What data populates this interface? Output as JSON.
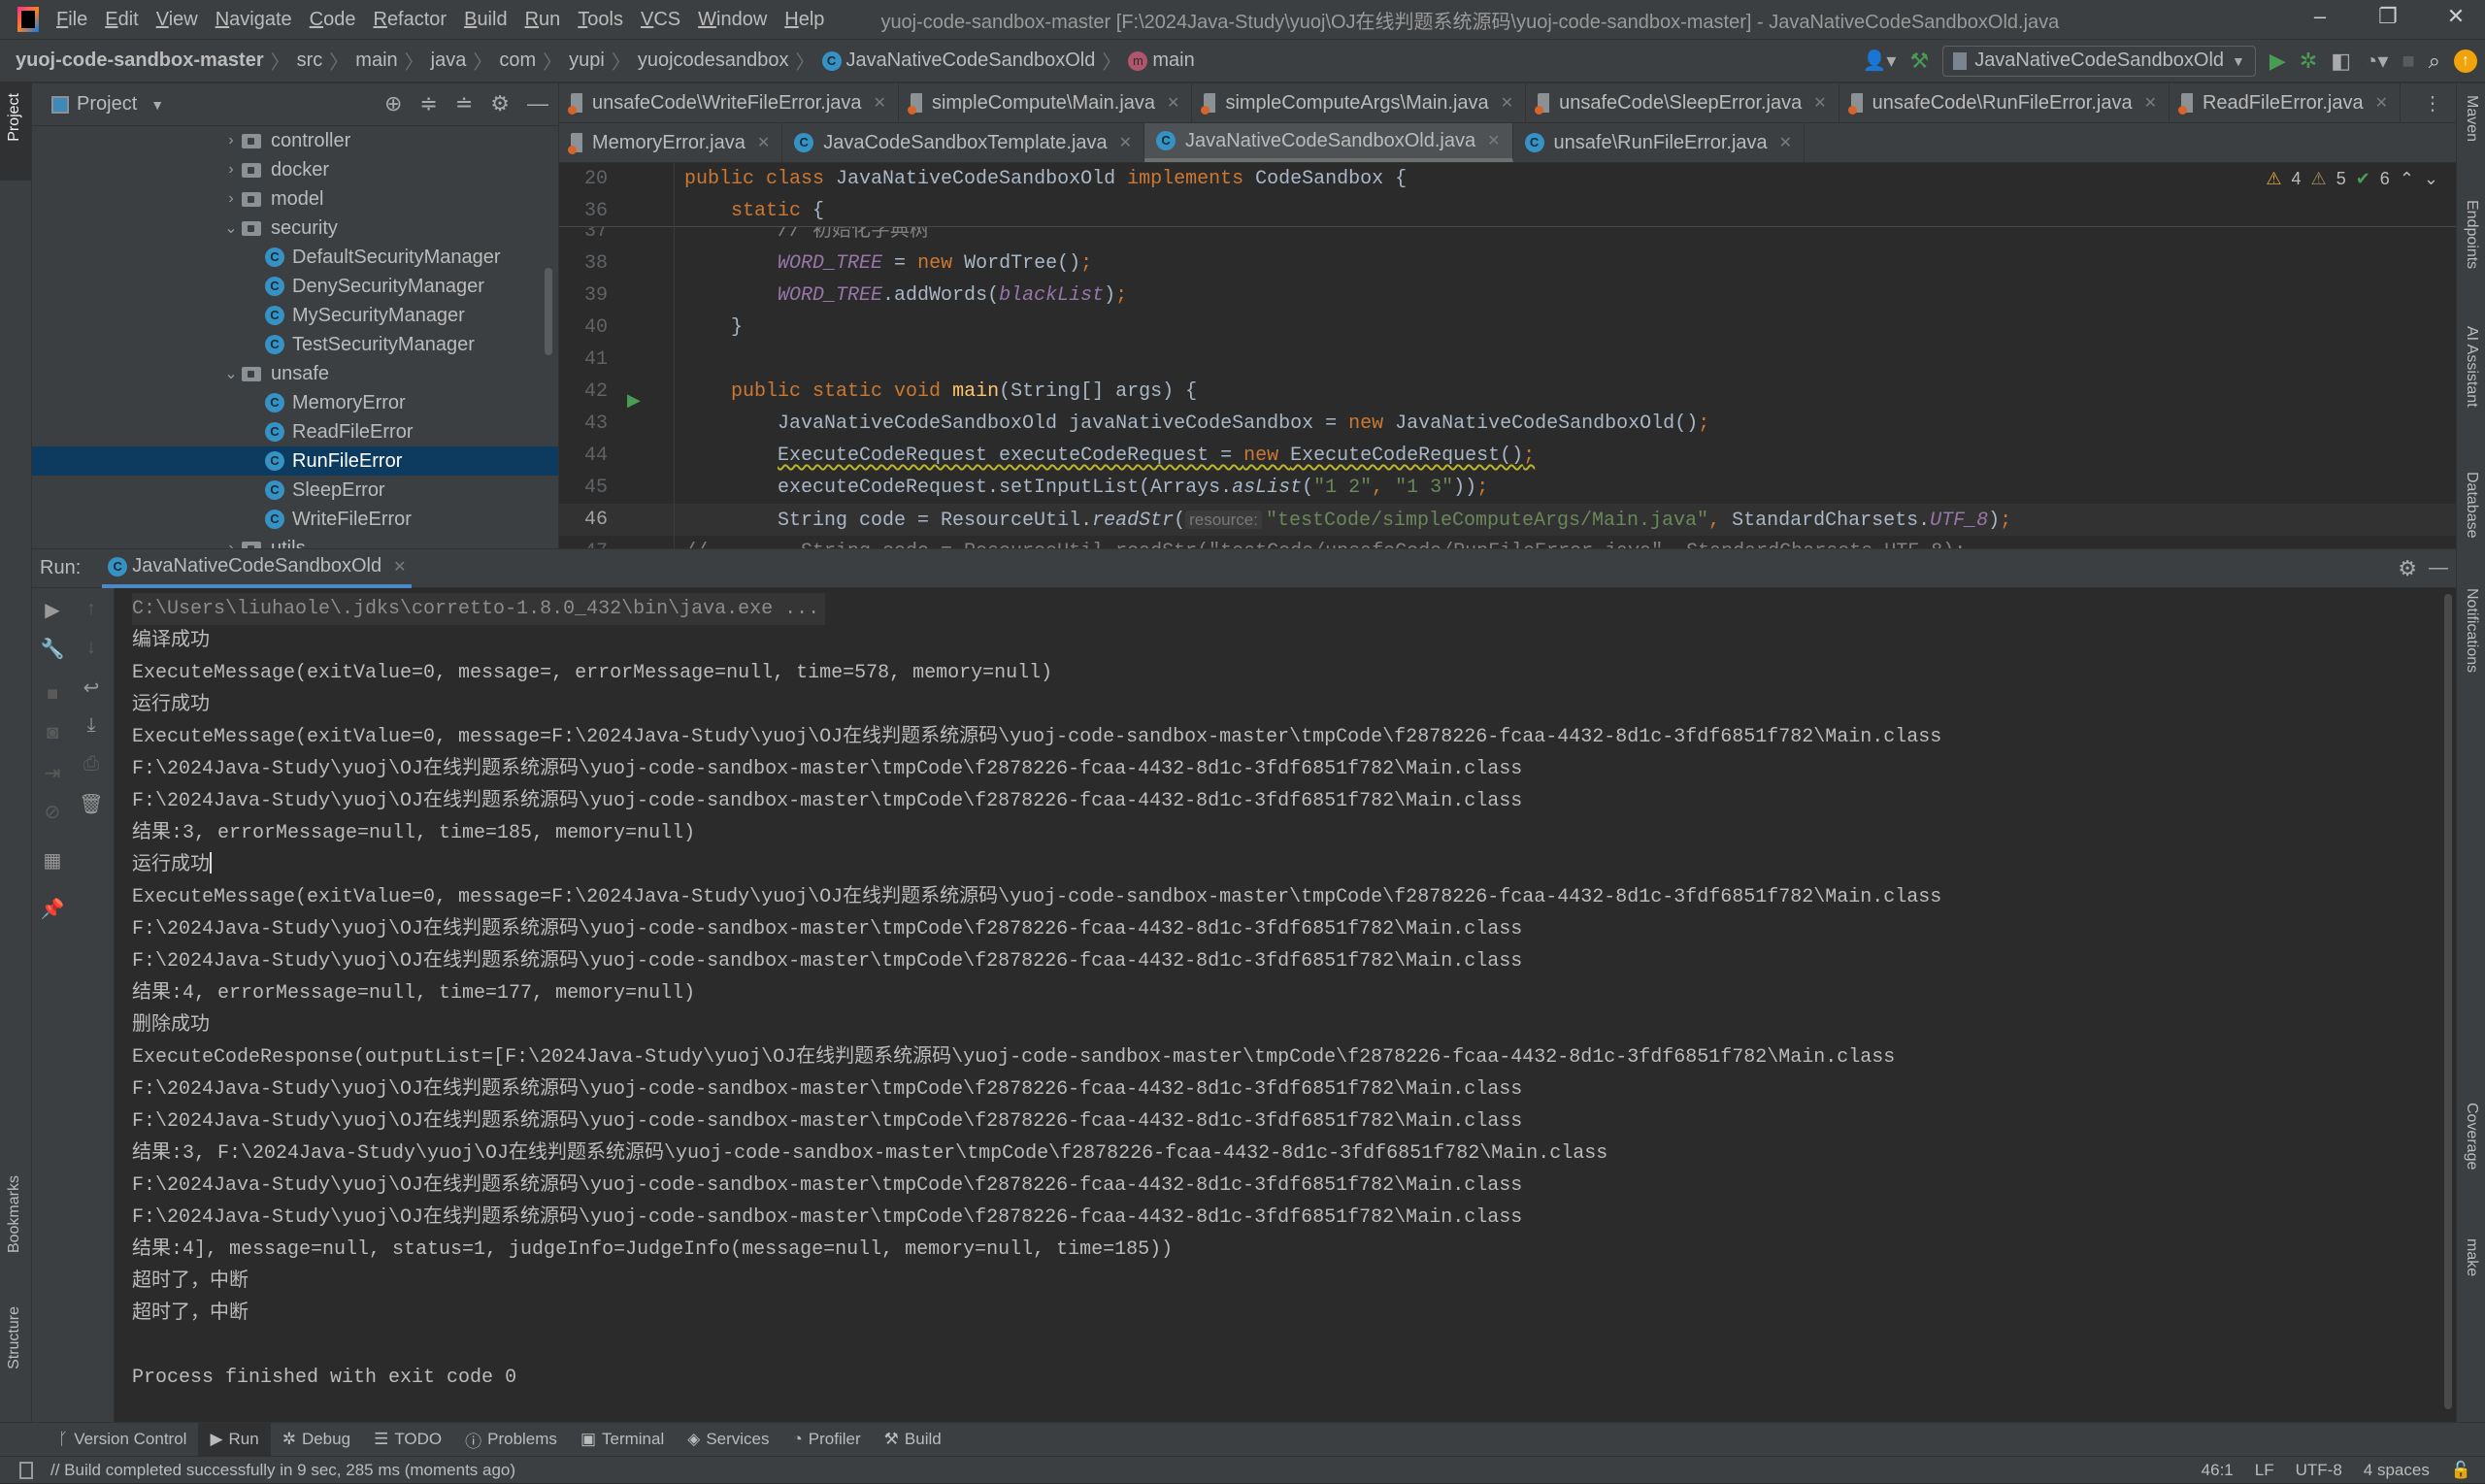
{
  "window": {
    "title": "yuoj-code-sandbox-master [F:\\2024Java-Study\\yuoj\\OJ在线判题系统源码\\yuoj-code-sandbox-master] - JavaNativeCodeSandboxOld.java",
    "menu": [
      "File",
      "Edit",
      "View",
      "Navigate",
      "Code",
      "Refactor",
      "Build",
      "Run",
      "Tools",
      "VCS",
      "Window",
      "Help"
    ]
  },
  "breadcrumb": {
    "items": [
      "yuoj-code-sandbox-master",
      "src",
      "main",
      "java",
      "com",
      "yupi",
      "yuojcodesandbox",
      "JavaNativeCodeSandboxOld",
      "main"
    ],
    "run_config": "JavaNativeCodeSandboxOld"
  },
  "left_stripe": {
    "project": "Project",
    "bookmarks": "Bookmarks",
    "structure": "Structure"
  },
  "right_stripe": [
    "Maven",
    "Endpoints",
    "AI Assistant",
    "Database",
    "Notifications",
    "Coverage",
    "make"
  ],
  "project": {
    "title": "Project",
    "tree": [
      {
        "label": "controller",
        "type": "folder",
        "level": 0,
        "state": "collapsed"
      },
      {
        "label": "docker",
        "type": "folder",
        "level": 0,
        "state": "collapsed"
      },
      {
        "label": "model",
        "type": "folder",
        "level": 0,
        "state": "collapsed"
      },
      {
        "label": "security",
        "type": "folder",
        "level": 0,
        "state": "expanded"
      },
      {
        "label": "DefaultSecurityManager",
        "type": "class",
        "level": 1
      },
      {
        "label": "DenySecurityManager",
        "type": "class",
        "level": 1
      },
      {
        "label": "MySecurityManager",
        "type": "class",
        "level": 1
      },
      {
        "label": "TestSecurityManager",
        "type": "class",
        "level": 1
      },
      {
        "label": "unsafe",
        "type": "folder",
        "level": 0,
        "state": "expanded"
      },
      {
        "label": "MemoryError",
        "type": "class",
        "level": 1
      },
      {
        "label": "ReadFileError",
        "type": "class",
        "level": 1
      },
      {
        "label": "RunFileError",
        "type": "class",
        "level": 1,
        "selected": true
      },
      {
        "label": "SleepError",
        "type": "class",
        "level": 1
      },
      {
        "label": "WriteFileError",
        "type": "class",
        "level": 1
      },
      {
        "label": "utils",
        "type": "folder",
        "level": 0,
        "state": "collapsed"
      }
    ]
  },
  "editor": {
    "tabs_row1": [
      {
        "label": "unsafeCode\\WriteFileError.java",
        "icon": "java-file"
      },
      {
        "label": "simpleCompute\\Main.java",
        "icon": "java-file"
      },
      {
        "label": "simpleComputeArgs\\Main.java",
        "icon": "java-file"
      },
      {
        "label": "unsafeCode\\SleepError.java",
        "icon": "java-file"
      },
      {
        "label": "unsafeCode\\RunFileError.java",
        "icon": "java-file"
      },
      {
        "label": "ReadFileError.java",
        "icon": "java-file"
      }
    ],
    "tabs_row2": [
      {
        "label": "MemoryError.java",
        "icon": "java-file"
      },
      {
        "label": "JavaCodeSandboxTemplate.java",
        "icon": "class"
      },
      {
        "label": "JavaNativeCodeSandboxOld.java",
        "icon": "class",
        "active": true
      },
      {
        "label": "unsafe\\RunFileError.java",
        "icon": "class"
      }
    ],
    "inspections": {
      "warnings_a": "4",
      "warnings_b": "5",
      "ok": "6"
    },
    "sticky_lines": [
      {
        "num": "20",
        "tokens": [
          [
            "k",
            "public class "
          ],
          [
            "t",
            "JavaNativeCodeSandboxOld "
          ],
          [
            "k",
            "implements "
          ],
          [
            "t",
            "CodeSandbox {"
          ]
        ]
      },
      {
        "num": "36",
        "tokens": [
          [
            "t",
            "    "
          ],
          [
            "k",
            "static "
          ],
          [
            "t",
            "{"
          ]
        ]
      }
    ],
    "lines": [
      {
        "num": "37",
        "tokens": [
          [
            "c",
            "        // 初始化字典树"
          ]
        ]
      },
      {
        "num": "38",
        "tokens": [
          [
            "t",
            "        "
          ],
          [
            "f",
            "WORD_TREE"
          ],
          [
            "t",
            " = "
          ],
          [
            "k",
            "new "
          ],
          [
            "t",
            "WordTree()"
          ],
          [
            "k",
            ";"
          ]
        ]
      },
      {
        "num": "39",
        "tokens": [
          [
            "t",
            "        "
          ],
          [
            "f",
            "WORD_TREE"
          ],
          [
            "t",
            ".addWords("
          ],
          [
            "f",
            "blackList"
          ],
          [
            "t",
            ")"
          ],
          [
            "k",
            ";"
          ]
        ]
      },
      {
        "num": "40",
        "tokens": [
          [
            "t",
            "    }"
          ]
        ]
      },
      {
        "num": "41",
        "tokens": []
      },
      {
        "num": "42",
        "tokens": [
          [
            "t",
            "    "
          ],
          [
            "k",
            "public static void "
          ],
          [
            "m",
            "main"
          ],
          [
            "t",
            "(String[] args) {"
          ]
        ]
      },
      {
        "num": "43",
        "tokens": [
          [
            "t",
            "        JavaNativeCodeSandboxOld javaNativeCodeSandbox = "
          ],
          [
            "k",
            "new "
          ],
          [
            "t",
            "JavaNativeCodeSandboxOld()"
          ],
          [
            "k",
            ";"
          ]
        ]
      },
      {
        "num": "44",
        "tokens": [
          [
            "t",
            "        "
          ],
          [
            "tu",
            "ExecuteCodeRequest executeCodeRequest = "
          ],
          [
            "ku",
            "new "
          ],
          [
            "tu",
            "ExecuteCodeRequest()"
          ],
          [
            "ku",
            ";"
          ]
        ]
      },
      {
        "num": "45",
        "tokens": [
          [
            "t",
            "        executeCodeRequest.setInputList(Arrays."
          ],
          [
            "i",
            "asList"
          ],
          [
            "t",
            "("
          ],
          [
            "s",
            "\"1 2\""
          ],
          [
            "k",
            ", "
          ],
          [
            "s",
            "\"1 3\""
          ],
          [
            "t",
            "))"
          ],
          [
            "k",
            ";"
          ]
        ]
      },
      {
        "num": "46",
        "current": true,
        "tokens": [
          [
            "t",
            "        String code = ResourceUtil."
          ],
          [
            "i",
            "readStr"
          ],
          [
            "t",
            "("
          ],
          [
            "h",
            "resource:"
          ],
          [
            "s",
            "\"testCode/simpleComputeArgs/Main.java\""
          ],
          [
            "k",
            ", "
          ],
          [
            "t",
            "StandardCharsets."
          ],
          [
            "f",
            "UTF_8"
          ],
          [
            "t",
            ")"
          ],
          [
            "k",
            ";"
          ]
        ]
      },
      {
        "num": "47",
        "tokens": [
          [
            "c",
            "//        String code = ResourceUtil.readStr(\"testCode/unsafeCode/RunFileError.java\", StandardCharsets.UTF_8);"
          ]
        ]
      }
    ]
  },
  "run": {
    "label": "Run:",
    "tab": "JavaNativeCodeSandboxOld",
    "output": [
      {
        "text": "C:\\Users\\liuhaole\\.jdks\\corretto-1.8.0_432\\bin\\java.exe ...",
        "type": "cmd"
      },
      {
        "text": "编译成功"
      },
      {
        "text": "ExecuteMessage(exitValue=0, message=, errorMessage=null, time=578, memory=null)"
      },
      {
        "text": "运行成功"
      },
      {
        "text": "ExecuteMessage(exitValue=0, message=F:\\2024Java-Study\\yuoj\\OJ在线判题系统源码\\yuoj-code-sandbox-master\\tmpCode\\f2878226-fcaa-4432-8d1c-3fdf6851f782\\Main.class"
      },
      {
        "text": "F:\\2024Java-Study\\yuoj\\OJ在线判题系统源码\\yuoj-code-sandbox-master\\tmpCode\\f2878226-fcaa-4432-8d1c-3fdf6851f782\\Main.class"
      },
      {
        "text": "F:\\2024Java-Study\\yuoj\\OJ在线判题系统源码\\yuoj-code-sandbox-master\\tmpCode\\f2878226-fcaa-4432-8d1c-3fdf6851f782\\Main.class"
      },
      {
        "text": "结果:3, errorMessage=null, time=185, memory=null)"
      },
      {
        "text": "运行成功",
        "cursor": true
      },
      {
        "text": "ExecuteMessage(exitValue=0, message=F:\\2024Java-Study\\yuoj\\OJ在线判题系统源码\\yuoj-code-sandbox-master\\tmpCode\\f2878226-fcaa-4432-8d1c-3fdf6851f782\\Main.class"
      },
      {
        "text": "F:\\2024Java-Study\\yuoj\\OJ在线判题系统源码\\yuoj-code-sandbox-master\\tmpCode\\f2878226-fcaa-4432-8d1c-3fdf6851f782\\Main.class"
      },
      {
        "text": "F:\\2024Java-Study\\yuoj\\OJ在线判题系统源码\\yuoj-code-sandbox-master\\tmpCode\\f2878226-fcaa-4432-8d1c-3fdf6851f782\\Main.class"
      },
      {
        "text": "结果:4, errorMessage=null, time=177, memory=null)"
      },
      {
        "text": "删除成功"
      },
      {
        "text": "ExecuteCodeResponse(outputList=[F:\\2024Java-Study\\yuoj\\OJ在线判题系统源码\\yuoj-code-sandbox-master\\tmpCode\\f2878226-fcaa-4432-8d1c-3fdf6851f782\\Main.class"
      },
      {
        "text": "F:\\2024Java-Study\\yuoj\\OJ在线判题系统源码\\yuoj-code-sandbox-master\\tmpCode\\f2878226-fcaa-4432-8d1c-3fdf6851f782\\Main.class"
      },
      {
        "text": "F:\\2024Java-Study\\yuoj\\OJ在线判题系统源码\\yuoj-code-sandbox-master\\tmpCode\\f2878226-fcaa-4432-8d1c-3fdf6851f782\\Main.class"
      },
      {
        "text": "结果:3, F:\\2024Java-Study\\yuoj\\OJ在线判题系统源码\\yuoj-code-sandbox-master\\tmpCode\\f2878226-fcaa-4432-8d1c-3fdf6851f782\\Main.class"
      },
      {
        "text": "F:\\2024Java-Study\\yuoj\\OJ在线判题系统源码\\yuoj-code-sandbox-master\\tmpCode\\f2878226-fcaa-4432-8d1c-3fdf6851f782\\Main.class"
      },
      {
        "text": "F:\\2024Java-Study\\yuoj\\OJ在线判题系统源码\\yuoj-code-sandbox-master\\tmpCode\\f2878226-fcaa-4432-8d1c-3fdf6851f782\\Main.class"
      },
      {
        "text": "结果:4], message=null, status=1, judgeInfo=JudgeInfo(message=null, memory=null, time=185))"
      },
      {
        "text": "超时了，中断"
      },
      {
        "text": "超时了，中断"
      },
      {
        "text": ""
      },
      {
        "text": "Process finished with exit code 0"
      }
    ]
  },
  "tool_windows": [
    {
      "label": "Version Control",
      "icon": "branch-icon"
    },
    {
      "label": "Run",
      "icon": "play-icon",
      "active": true
    },
    {
      "label": "Debug",
      "icon": "bug-icon"
    },
    {
      "label": "TODO",
      "icon": "list-icon"
    },
    {
      "label": "Problems",
      "icon": "problems-icon"
    },
    {
      "label": "Terminal",
      "icon": "terminal-icon"
    },
    {
      "label": "Services",
      "icon": "services-icon"
    },
    {
      "label": "Profiler",
      "icon": "profiler-icon"
    },
    {
      "label": "Build",
      "icon": "hammer-icon"
    }
  ],
  "status": {
    "message": "// Build completed successfully in 9 sec, 285 ms (moments ago)",
    "position": "46:1",
    "line_sep": "LF",
    "encoding": "UTF-8",
    "indent": "4 spaces"
  },
  "colors": {
    "keyword": "#cc7832",
    "string": "#6a8759",
    "field": "#9876aa",
    "method": "#ffc66d",
    "run_green": "#499c54",
    "selection": "#0d3a5f"
  }
}
